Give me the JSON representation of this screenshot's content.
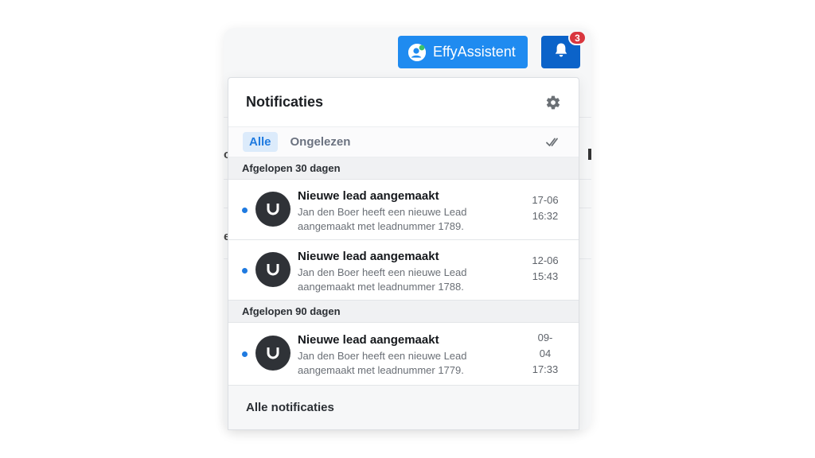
{
  "header": {
    "assistant_button_label": "EffyAssistent",
    "notification_badge_count": "3"
  },
  "background": {
    "left_chars": [
      "oj",
      "e"
    ]
  },
  "popover": {
    "title": "Notificaties",
    "tabs": [
      {
        "label": "Alle",
        "active": true
      },
      {
        "label": "Ongelezen",
        "active": false
      }
    ],
    "sections": [
      {
        "label": "Afgelopen 30 dagen",
        "items": [
          {
            "title": "Nieuwe lead aangemaakt",
            "body": "Jan den Boer heeft een nieuwe Lead aangemaakt met leadnummer 1789.",
            "time_lines": [
              "17-06",
              "16:32"
            ],
            "unread": true
          },
          {
            "title": "Nieuwe lead aangemaakt",
            "body": "Jan den Boer heeft een nieuwe Lead aangemaakt met leadnummer 1788.",
            "time_lines": [
              "12-06",
              "15:43"
            ],
            "unread": true
          }
        ]
      },
      {
        "label": "Afgelopen 90 dagen",
        "items": [
          {
            "title": "Nieuwe lead aangemaakt",
            "body": "Jan den Boer heeft een nieuwe Lead aangemaakt met leadnummer 1779.",
            "time_lines": [
              "09-",
              "04",
              "17:33"
            ],
            "unread": true
          }
        ]
      }
    ],
    "footer_link": "Alle notificaties"
  },
  "icons": {
    "settings": "gear-icon",
    "mark_all_read": "double-check-icon",
    "bell": "bell-icon",
    "assistant": "user-avatar-icon",
    "notification_avatar": "magnet-logo-icon"
  },
  "colors": {
    "primary": "#1f8bf0",
    "primary_dark": "#0b63c9",
    "badge": "#d9363e",
    "unread_dot": "#1f7ae0"
  }
}
